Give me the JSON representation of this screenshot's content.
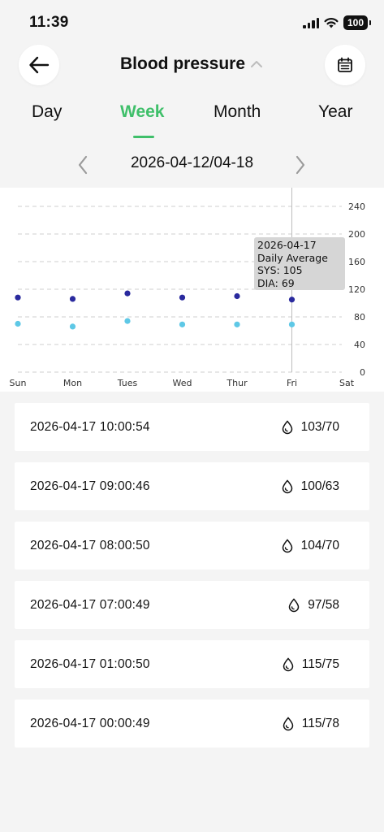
{
  "status_bar": {
    "time": "11:39",
    "battery": "100"
  },
  "header": {
    "title": "Blood pressure",
    "back_icon": "arrow-left-icon",
    "calendar_icon": "calendar-icon",
    "title_chevron_icon": "chevron-up-icon"
  },
  "tabs": [
    {
      "label": "Day",
      "active": false
    },
    {
      "label": "Week",
      "active": true
    },
    {
      "label": "Month",
      "active": false
    },
    {
      "label": "Year",
      "active": false
    }
  ],
  "date_nav": {
    "range": "2026-04-12/04-18",
    "prev_icon": "chevron-left-icon",
    "next_icon": "chevron-right-icon"
  },
  "chart_data": {
    "type": "scatter",
    "categories": [
      "Sun",
      "Mon",
      "Tues",
      "Wed",
      "Thur",
      "Fri",
      "Sat"
    ],
    "y_ticks": [
      "0",
      "40",
      "80",
      "120",
      "160",
      "200",
      "240"
    ],
    "ylim": [
      0,
      240
    ],
    "grid": true,
    "series": [
      {
        "key": "sys",
        "color": "#2a2a9e",
        "values": [
          108,
          106,
          114,
          108,
          110,
          105,
          null
        ]
      },
      {
        "key": "dia",
        "color": "#5ec8e6",
        "values": [
          70,
          66,
          74,
          69,
          69,
          69,
          null
        ]
      }
    ],
    "selected_category": "Fri",
    "tooltip": {
      "date": "2026-04-17",
      "label": "Daily Average",
      "sys": "SYS: 105",
      "dia": "DIA: 69"
    }
  },
  "readings": [
    {
      "time": "2026-04-17 10:00:54",
      "value": "103/70"
    },
    {
      "time": "2026-04-17 09:00:46",
      "value": "100/63"
    },
    {
      "time": "2026-04-17 08:00:50",
      "value": "104/70"
    },
    {
      "time": "2026-04-17 07:00:49",
      "value": "97/58"
    },
    {
      "time": "2026-04-17 01:00:50",
      "value": "115/75"
    },
    {
      "time": "2026-04-17 00:00:49",
      "value": "115/78"
    }
  ],
  "reading_icon": "blood-drop-icon",
  "colors": {
    "accent": "#3fbf6a",
    "sys": "#2a2a9e",
    "dia": "#5ec8e6"
  }
}
